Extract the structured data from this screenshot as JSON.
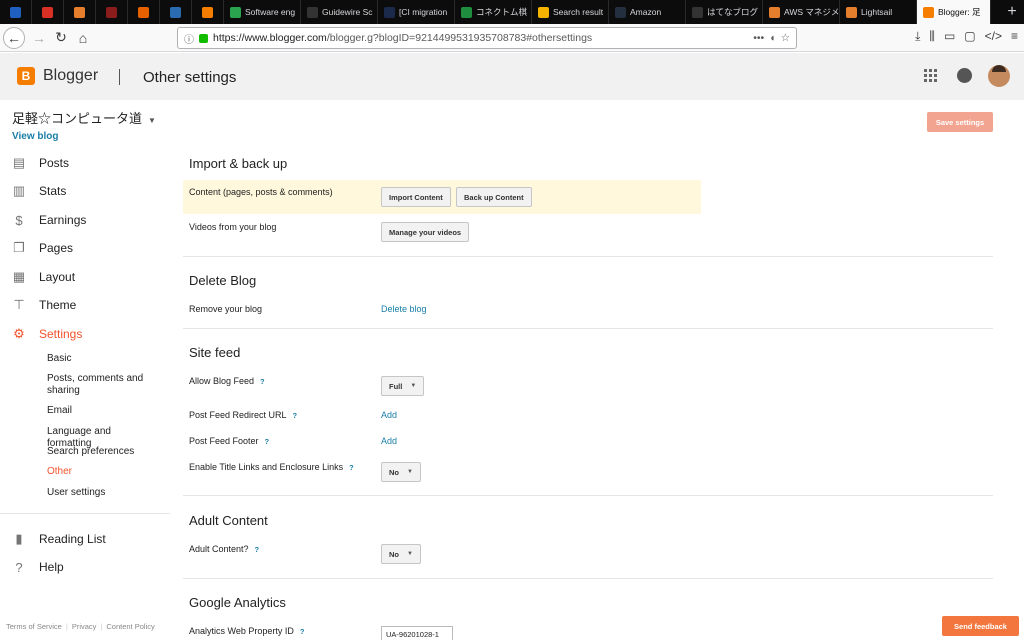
{
  "browser": {
    "tabs": [
      {
        "label": "",
        "icon": "rocket-icon",
        "color": "#1f5fbf"
      },
      {
        "label": "",
        "icon": "gmail-icon",
        "color": "#d93025"
      },
      {
        "label": "",
        "icon": "aws-icon",
        "color": "#e57f2e"
      },
      {
        "label": "",
        "icon": "circle-icon",
        "color": "#8a1c1c"
      },
      {
        "label": "",
        "icon": "firefox-icon",
        "color": "#e66000"
      },
      {
        "label": "",
        "icon": "star-icon",
        "color": "#2b6cb0"
      },
      {
        "label": "",
        "icon": "blogger-icon",
        "color": "#f57d00"
      },
      {
        "label": "Software eng",
        "icon": "doc-icon",
        "color": "#2aa44f"
      },
      {
        "label": "Guidewire Sc",
        "icon": "github-icon",
        "color": "#333333"
      },
      {
        "label": "[CI migration",
        "icon": "page-icon",
        "color": "#1b2a4a"
      },
      {
        "label": "コネクトム棋",
        "icon": "sheets-icon",
        "color": "#1e8e3e"
      },
      {
        "label": "Search result",
        "icon": "drive-icon",
        "color": "#f4b400"
      },
      {
        "label": "Amazon",
        "icon": "amazon-icon",
        "color": "#232f3e"
      },
      {
        "label": "はてなブログ",
        "icon": "hatena-icon",
        "color": "#333333"
      },
      {
        "label": "AWS マネジメ",
        "icon": "aws-icon",
        "color": "#e57f2e"
      },
      {
        "label": "Lightsail",
        "icon": "lightsail-icon",
        "color": "#e57f2e"
      },
      {
        "label": "Blogger: 足",
        "icon": "blogger-icon",
        "color": "#f57d00",
        "active": true
      }
    ],
    "url_host": "https://www.blogger.com",
    "url_path": "/blogger.g?blogID=9214499531935708783#othersettings",
    "url_dots": "•••"
  },
  "header": {
    "product": "Blogger",
    "page_title": "Other settings",
    "logo_letter": "B",
    "accent": "#f57d00"
  },
  "sidebar": {
    "blog_name": "足軽☆コンピュータ道",
    "view_blog": "View blog",
    "items": [
      {
        "label": "Posts",
        "icon": "posts-icon",
        "glyph": "▤"
      },
      {
        "label": "Stats",
        "icon": "stats-icon",
        "glyph": "▥"
      },
      {
        "label": "Earnings",
        "icon": "dollar-icon",
        "glyph": "$"
      },
      {
        "label": "Pages",
        "icon": "pages-icon",
        "glyph": "❐"
      },
      {
        "label": "Layout",
        "icon": "layout-icon",
        "glyph": "▦"
      },
      {
        "label": "Theme",
        "icon": "paint-roller-icon",
        "glyph": "⊤"
      },
      {
        "label": "Settings",
        "icon": "gear-icon",
        "glyph": "⚙",
        "active": true
      }
    ],
    "subitems": [
      {
        "label": "Basic"
      },
      {
        "label": "Posts, comments and sharing"
      },
      {
        "label": "Email"
      },
      {
        "label": "Language and formatting"
      },
      {
        "label": "Search preferences"
      },
      {
        "label": "Other",
        "active": true
      },
      {
        "label": "User settings"
      }
    ],
    "reading_list": "Reading List",
    "help": "Help",
    "footer": {
      "terms": "Terms of Service",
      "privacy": "Privacy",
      "content_policy": "Content Policy",
      "sep": "|"
    }
  },
  "main": {
    "save_button": "Save settings",
    "import_backup": {
      "title": "Import & back up",
      "content_label": "Content (pages, posts & comments)",
      "import_button": "Import Content",
      "backup_button": "Back up Content",
      "videos_label": "Videos from your blog",
      "manage_videos_button": "Manage your videos"
    },
    "delete_blog": {
      "title": "Delete Blog",
      "remove_label": "Remove your blog",
      "delete_link": "Delete blog"
    },
    "site_feed": {
      "title": "Site feed",
      "allow_feed_label": "Allow Blog Feed",
      "allow_feed_value": "Full",
      "redirect_label": "Post Feed Redirect URL",
      "redirect_action": "Add",
      "footer_label": "Post Feed Footer",
      "footer_action": "Add",
      "title_links_label": "Enable Title Links and Enclosure Links",
      "title_links_value": "No"
    },
    "adult": {
      "title": "Adult Content",
      "label": "Adult Content?",
      "value": "No"
    },
    "analytics": {
      "title": "Google Analytics",
      "label": "Analytics Web Property ID",
      "value": "UA-96201028-1"
    },
    "help_mark": "?",
    "feedback_button": "Send feedback"
  }
}
